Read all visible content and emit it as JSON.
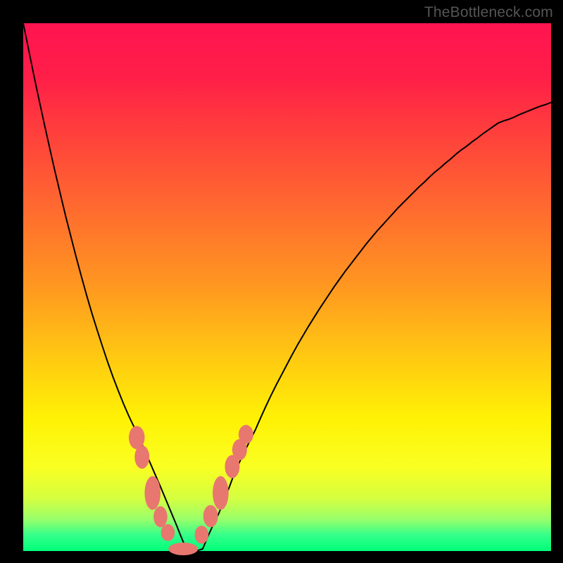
{
  "watermark": "TheBottleneck.com",
  "colors": {
    "frame_bg": "#000000",
    "watermark": "#555555",
    "curve": "#000000",
    "blob": "#e8776f",
    "gradient_stops": [
      "#ff1450",
      "#ff3d3d",
      "#ff9820",
      "#fff205",
      "#00ff7a"
    ]
  },
  "chart_data": {
    "type": "line",
    "title": "",
    "xlabel": "",
    "ylabel": "",
    "xlim": [
      0,
      100
    ],
    "ylim": [
      0,
      100
    ],
    "x": [
      0,
      1,
      2,
      3,
      4,
      5,
      6,
      7,
      8,
      9,
      10,
      11,
      12,
      13,
      14,
      15,
      16,
      17,
      18,
      19,
      20,
      21,
      22,
      23,
      24,
      25,
      26,
      27,
      28,
      29,
      30,
      31,
      32,
      33,
      34,
      35,
      36,
      37,
      38,
      39,
      40,
      41,
      42,
      43,
      44,
      45,
      46,
      47,
      48,
      49,
      50,
      51,
      52,
      53,
      54,
      55,
      56,
      57,
      58,
      59,
      60,
      61,
      62,
      63,
      64,
      65,
      66,
      67,
      68,
      69,
      70,
      71,
      72,
      73,
      74,
      75,
      76,
      77,
      78,
      79,
      80,
      81,
      82,
      83,
      84,
      85,
      86,
      87,
      88,
      89,
      90,
      91,
      92,
      93,
      94,
      95,
      96,
      97,
      98,
      99,
      100
    ],
    "series": [
      {
        "name": "bottleneck-curve",
        "values": [
          100.0,
          95.1,
          90.2,
          85.5,
          80.9,
          76.4,
          72.0,
          67.8,
          63.6,
          59.7,
          55.8,
          52.1,
          48.5,
          45.1,
          41.9,
          38.8,
          35.8,
          33.0,
          30.4,
          27.9,
          25.6,
          23.5,
          21.4,
          19.1,
          16.8,
          14.5,
          12.2,
          9.8,
          7.4,
          5.0,
          2.5,
          0.1,
          0.0,
          0.1,
          0.4,
          2.8,
          5.0,
          7.0,
          9.5,
          12.0,
          14.7,
          16.9,
          19.0,
          21.0,
          23.0,
          25.3,
          27.5,
          29.6,
          31.6,
          33.5,
          35.4,
          37.3,
          39.1,
          40.8,
          42.5,
          44.1,
          45.7,
          47.2,
          48.7,
          50.2,
          51.6,
          53.0,
          54.3,
          55.6,
          56.9,
          58.2,
          59.4,
          60.6,
          61.7,
          62.8,
          63.9,
          65.0,
          66.0,
          67.0,
          68.0,
          69.0,
          69.9,
          70.9,
          71.8,
          72.6,
          73.5,
          74.3,
          75.2,
          76.0,
          76.7,
          77.5,
          78.2,
          79.0,
          79.7,
          80.4,
          81.1,
          81.5,
          81.8,
          82.2,
          82.7,
          83.1,
          83.5,
          83.9,
          84.3,
          84.6,
          85.0
        ]
      }
    ],
    "markers": [
      {
        "name": "blob-left-1",
        "cx": 21.5,
        "cy": 21.5,
        "rx": 1.5,
        "ry": 2.2
      },
      {
        "name": "blob-left-2",
        "cx": 22.5,
        "cy": 17.8,
        "rx": 1.4,
        "ry": 2.2
      },
      {
        "name": "blob-left-3",
        "cx": 24.5,
        "cy": 11.0,
        "rx": 1.5,
        "ry": 3.2
      },
      {
        "name": "blob-left-4",
        "cx": 26.0,
        "cy": 6.5,
        "rx": 1.3,
        "ry": 2.0
      },
      {
        "name": "blob-left-5",
        "cx": 27.4,
        "cy": 3.5,
        "rx": 1.3,
        "ry": 1.6
      },
      {
        "name": "blob-bottom",
        "cx": 30.3,
        "cy": 0.4,
        "rx": 2.8,
        "ry": 1.2
      },
      {
        "name": "blob-right-1",
        "cx": 33.8,
        "cy": 3.1,
        "rx": 1.3,
        "ry": 1.7
      },
      {
        "name": "blob-right-2",
        "cx": 35.5,
        "cy": 6.6,
        "rx": 1.4,
        "ry": 2.1
      },
      {
        "name": "blob-right-3",
        "cx": 37.4,
        "cy": 11.0,
        "rx": 1.5,
        "ry": 3.2
      },
      {
        "name": "blob-right-4",
        "cx": 39.6,
        "cy": 16.0,
        "rx": 1.4,
        "ry": 2.2
      },
      {
        "name": "blob-right-5",
        "cx": 41.0,
        "cy": 19.2,
        "rx": 1.4,
        "ry": 2.0
      },
      {
        "name": "blob-right-6",
        "cx": 42.2,
        "cy": 22.1,
        "rx": 1.4,
        "ry": 1.8
      }
    ]
  }
}
